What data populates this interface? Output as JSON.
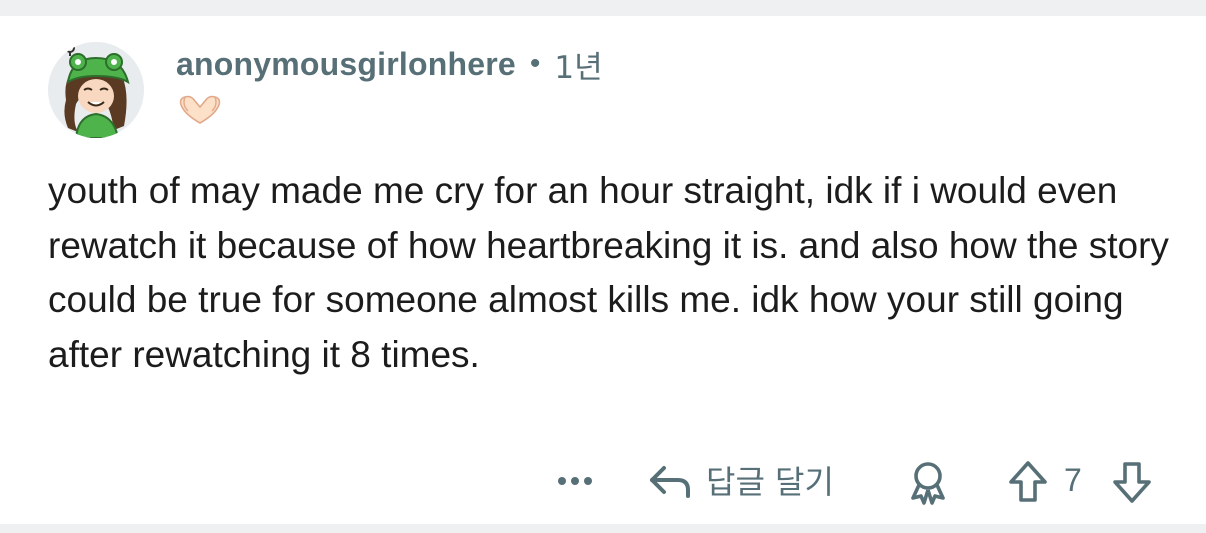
{
  "comment": {
    "author": "anonymousgirlonhere",
    "separator": "•",
    "age": "1년",
    "flair_icon": "heart-hands-emoji",
    "body": "youth of may made me cry for an hour straight, idk if i would even rewatch it because of how heartbreaking it is. and also how the story could be true for someone almost kills me. idk how your still going after rewatching it 8 times."
  },
  "actions": {
    "more_icon": "more-dots-icon",
    "reply_label": "답글 달기",
    "award_icon": "award-icon",
    "score": "7"
  },
  "colors": {
    "meta": "#576f76",
    "text": "#1c1c1c",
    "band": "#eef0f1"
  }
}
